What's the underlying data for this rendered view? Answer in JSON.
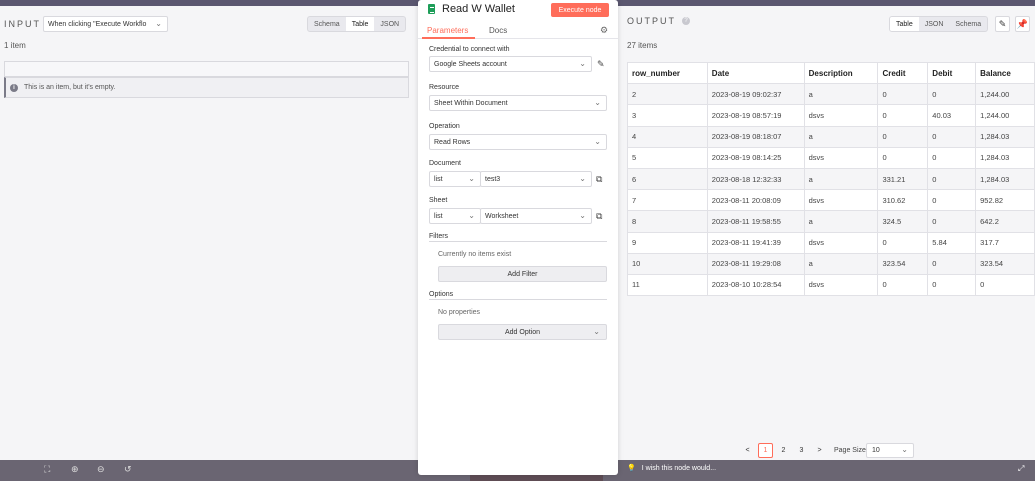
{
  "input": {
    "title": "INPUT",
    "trigger_select": "When clicking \"Execute Workflo",
    "views": [
      "Schema",
      "Table",
      "JSON"
    ],
    "active_view": "Table",
    "item_count": "1 item",
    "empty_message": "This is an item, but it's empty."
  },
  "node": {
    "title": "Read W Wallet",
    "execute_label": "Execute node",
    "tabs": [
      "Parameters",
      "Docs"
    ],
    "credential_label": "Credential to connect with",
    "credential_value": "Google Sheets account",
    "resource_label": "Resource",
    "resource_value": "Sheet Within Document",
    "operation_label": "Operation",
    "operation_value": "Read Rows",
    "document_label": "Document",
    "document_mode": "list",
    "document_value": "test3",
    "sheet_label": "Sheet",
    "sheet_mode": "list",
    "sheet_value": "Worksheet",
    "filters_label": "Filters",
    "filters_empty": "Currently no items exist",
    "add_filter": "Add Filter",
    "options_label": "Options",
    "options_empty": "No properties",
    "add_option": "Add Option"
  },
  "output": {
    "title": "OUTPUT",
    "help_icon": "?",
    "views": [
      "Table",
      "JSON",
      "Schema"
    ],
    "active_view": "Table",
    "item_count": "27 items",
    "columns": [
      "row_number",
      "Date",
      "Description",
      "Credit",
      "Debit",
      "Balance"
    ],
    "rows": [
      [
        "2",
        "2023-08-19 09:02:37",
        "a",
        "0",
        "0",
        "1,244.00"
      ],
      [
        "3",
        "2023-08-19 08:57:19",
        "dsvs",
        "0",
        "40.03",
        "1,244.00"
      ],
      [
        "4",
        "2023-08-19 08:18:07",
        "a",
        "0",
        "0",
        "1,284.03"
      ],
      [
        "5",
        "2023-08-19 08:14:25",
        "dsvs",
        "0",
        "0",
        "1,284.03"
      ],
      [
        "6",
        "2023-08-18 12:32:33",
        "a",
        "331.21",
        "0",
        "1,284.03"
      ],
      [
        "7",
        "2023-08-11 20:08:09",
        "dsvs",
        "310.62",
        "0",
        "952.82"
      ],
      [
        "8",
        "2023-08-11 19:58:55",
        "a",
        "324.5",
        "0",
        "642.2"
      ],
      [
        "9",
        "2023-08-11 19:41:39",
        "dsvs",
        "0",
        "5.84",
        "317.7"
      ],
      [
        "10",
        "2023-08-11 19:29:08",
        "a",
        "323.54",
        "0",
        "323.54"
      ],
      [
        "11",
        "2023-08-10 10:28:54",
        "dsvs",
        "0",
        "0",
        "0"
      ]
    ],
    "pagination": {
      "prev": "<",
      "pages": [
        "1",
        "2",
        "3"
      ],
      "current": "1",
      "next": ">",
      "page_size_label": "Page Size",
      "page_size": "10"
    }
  },
  "footer": {
    "feedback": "I wish this node would..."
  },
  "colors": {
    "accent": "#ff6d5a",
    "sheets_green": "#1e9e59"
  }
}
